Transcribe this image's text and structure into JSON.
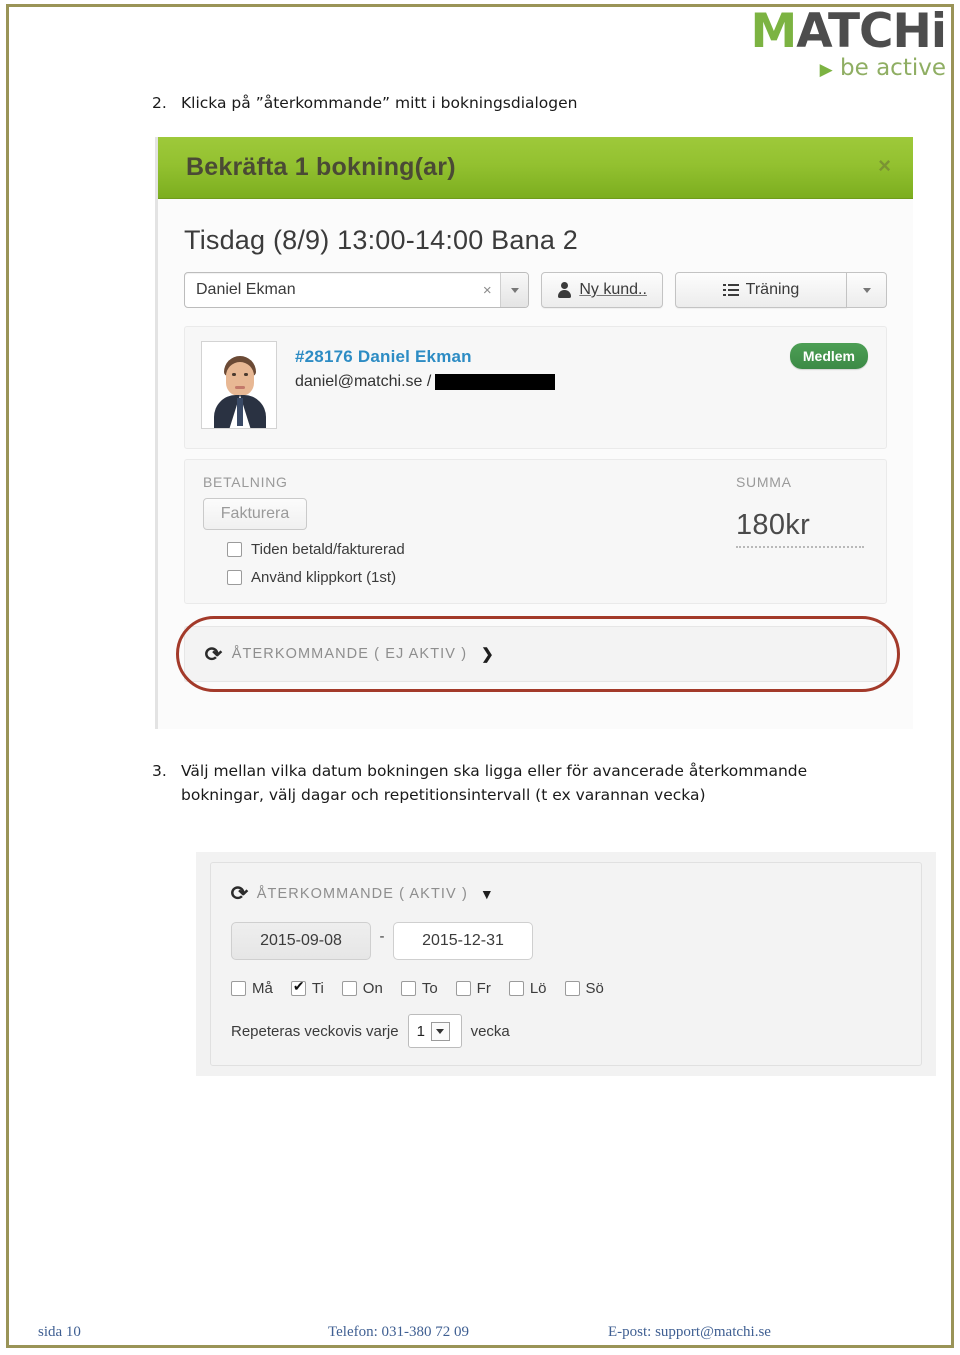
{
  "brand": {
    "logo_text_1": "M",
    "logo_text_2": "ATCH",
    "logo_text_3": "i",
    "tagline_arrow": "▶",
    "tagline": "be active",
    "accent_green": "#7cb342",
    "frame_olive": "#9a9457"
  },
  "steps": {
    "step2_number": "2.",
    "step2_text": "Klicka på ”återkommande” mitt i bokningsdialogen",
    "step3_number": "3.",
    "step3_text": "Välj mellan vilka datum bokningen ska ligga eller för avancerade återkommande bokningar, välj dagar och repetitionsintervall (t ex varannan vecka)"
  },
  "dialog": {
    "title": "Bekräfta 1 bokning(ar)",
    "close_icon": "×",
    "subtitle": "Tisdag (8/9) 13:00-14:00 Bana 2",
    "customer_select": {
      "value": "Daniel Ekman",
      "clear_icon": "×",
      "caret_icon": "▼"
    },
    "new_customer_button": {
      "label": "Ny kund..",
      "icon": "person-icon"
    },
    "training_button": {
      "label": "Träning",
      "icon": "list-icon",
      "caret_icon": "▼"
    },
    "user_card": {
      "id": "#28176",
      "name": "Daniel Ekman",
      "email": "daniel@matchi.se /",
      "badge": "Medlem",
      "badge_color": "#3c8a46"
    },
    "payment": {
      "section_label": "BETALNING",
      "invoice_button": "Fakturera",
      "checkboxes": [
        {
          "label": "Tiden betald/fakturerad",
          "checked": false
        },
        {
          "label": "Använd klippkort (1st)",
          "checked": false
        }
      ],
      "summa_label": "SUMMA",
      "summa_value": "180kr"
    },
    "recurring_bar": {
      "icon": "refresh-icon",
      "label": "ÅTERKOMMANDE ( EJ AKTIV )",
      "chevron_icon": "❯",
      "highlight_color": "#a33a2a"
    }
  },
  "recurring_panel": {
    "icon": "refresh-icon",
    "label": "ÅTERKOMMANDE ( AKTIV )",
    "chevron_icon": "❤",
    "chevron_down_icon": "▼",
    "date_from": "2015-09-08",
    "date_separator": "-",
    "date_to": "2015-12-31",
    "days": [
      {
        "label": "Må",
        "checked": false
      },
      {
        "label": "Ti",
        "checked": true
      },
      {
        "label": "On",
        "checked": false
      },
      {
        "label": "To",
        "checked": false
      },
      {
        "label": "Fr",
        "checked": false
      },
      {
        "label": "Lö",
        "checked": false
      },
      {
        "label": "Sö",
        "checked": false
      }
    ],
    "repeat_prefix": "Repeteras veckovis varje",
    "repeat_value": "1",
    "repeat_suffix": "vecka"
  },
  "footer": {
    "page": "sida 10",
    "phone": "Telefon: 031-380 72 09",
    "email": "E-post: support@matchi.se"
  }
}
